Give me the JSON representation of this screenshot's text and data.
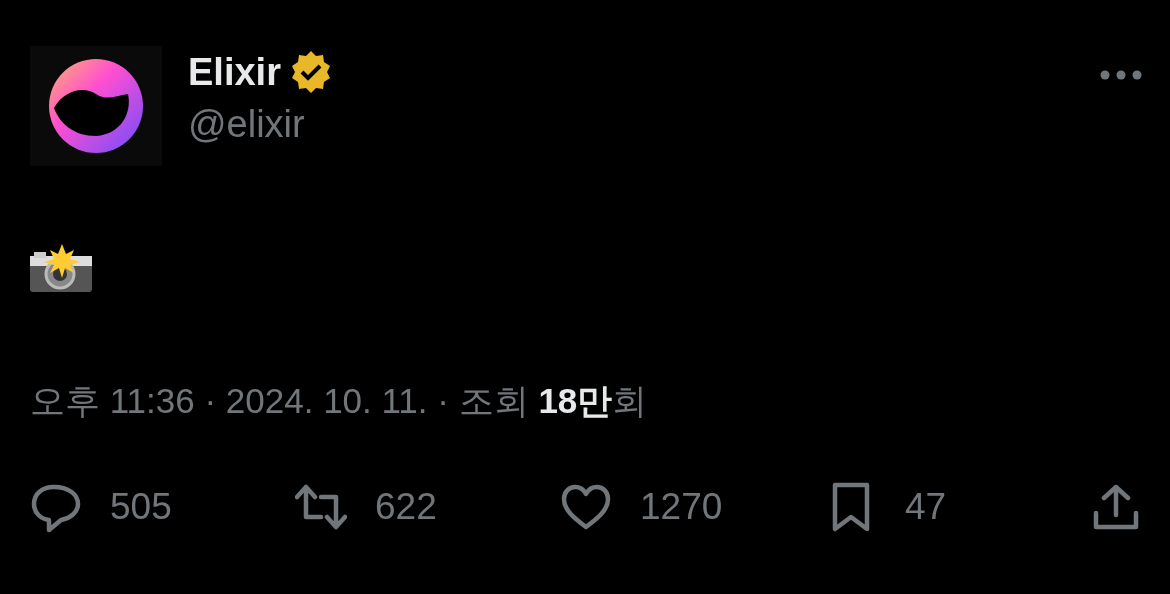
{
  "author": {
    "name": "Elixir",
    "verified": true,
    "handle": "@elixir"
  },
  "meta": "오후 11:36 · 2024. 10. 11. · 조회 **18만**회",
  "actions": [
    {
      "kind": "reply",
      "count": "505"
    },
    {
      "kind": "repost",
      "count": "622"
    },
    {
      "kind": "like",
      "count": "1270"
    },
    {
      "kind": "bookmark",
      "count": "47"
    },
    {
      "kind": "share"
    }
  ]
}
